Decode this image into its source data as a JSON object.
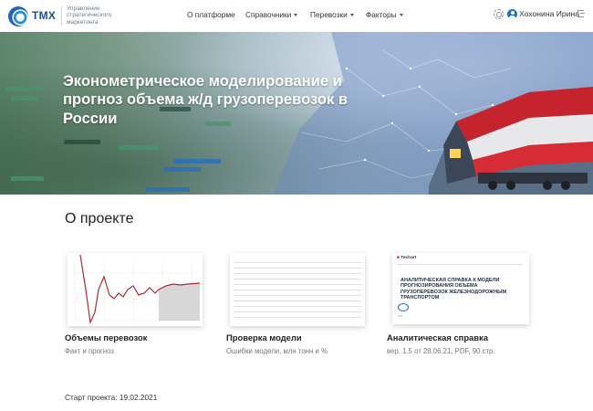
{
  "header": {
    "logo_text": "ТМХ",
    "logo_subtitle": "Управление стратегического маркетинга",
    "nav": [
      {
        "label": "О платформе",
        "has_dropdown": false
      },
      {
        "label": "Справочники",
        "has_dropdown": true
      },
      {
        "label": "Перевозки",
        "has_dropdown": true
      },
      {
        "label": "Факторы",
        "has_dropdown": true
      }
    ],
    "user_name": "Хохонина Ирина",
    "icons": [
      "gear-icon",
      "user-icon",
      "logout-icon"
    ]
  },
  "hero": {
    "title": "Эконометрическое моделирование и прогноз объема ж/д грузоперевозок в России"
  },
  "section": {
    "title": "О проекте"
  },
  "cards": [
    {
      "title": "Объемы перевозок",
      "subtitle": "Факт и прогноз"
    },
    {
      "title": "Проверка модели",
      "subtitle": "Ошибки модели, млн тонн и %"
    },
    {
      "title": "Аналитическая справка",
      "subtitle": "вер. 1.5 от 28.06.21, PDF, 90 стр."
    }
  ],
  "doc_preview": {
    "company": "Techart",
    "heading": "АНАЛИТИЧЕСКАЯ СПРАВКА К МОДЕЛИ ПРОГНОЗИРОВАНИЯ ОБЪЕМА ГРУЗОПЕРЕВОЗОК ЖЕЛЕЗНОДОРОЖНЫМ ТРАНСПОРТОМ",
    "logo": "ТМХ"
  },
  "project_start": "Старт проекта: 19.02.2021",
  "colors": {
    "brand": "#1c4f9c",
    "accent": "#1f6fc5",
    "chart_line": "#b02a3a"
  }
}
